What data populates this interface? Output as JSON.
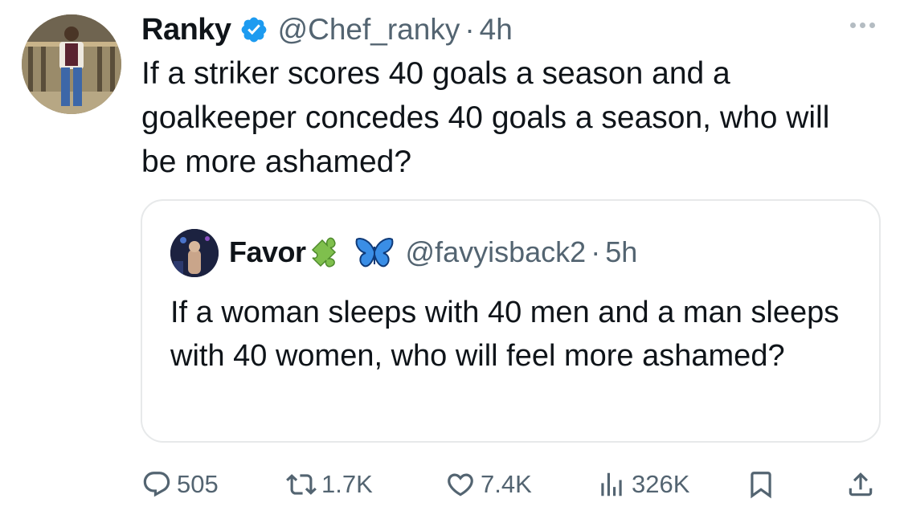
{
  "tweet": {
    "author_name": "Ranky",
    "handle": "@Chef_ranky",
    "separator": "·",
    "time": "4h",
    "text": "If a striker scores 40 goals a season and a goalkeeper concedes 40 goals a season, who will be more ashamed?"
  },
  "quoted": {
    "author_name": "Favor",
    "emojis": [
      "puzzle-piece-icon",
      "butterfly-icon"
    ],
    "handle": "@favyisback2",
    "separator": "·",
    "time": "5h",
    "text": "If a woman sleeps with 40 men and a man sleeps with 40 women, who will feel more ashamed?"
  },
  "actions": {
    "replies": "505",
    "reposts": "1.7K",
    "likes": "7.4K",
    "views": "326K"
  },
  "colors": {
    "text": "#0f1419",
    "secondary": "#536471",
    "verified": "#1d9bf0",
    "border": "#e7e9ea"
  }
}
